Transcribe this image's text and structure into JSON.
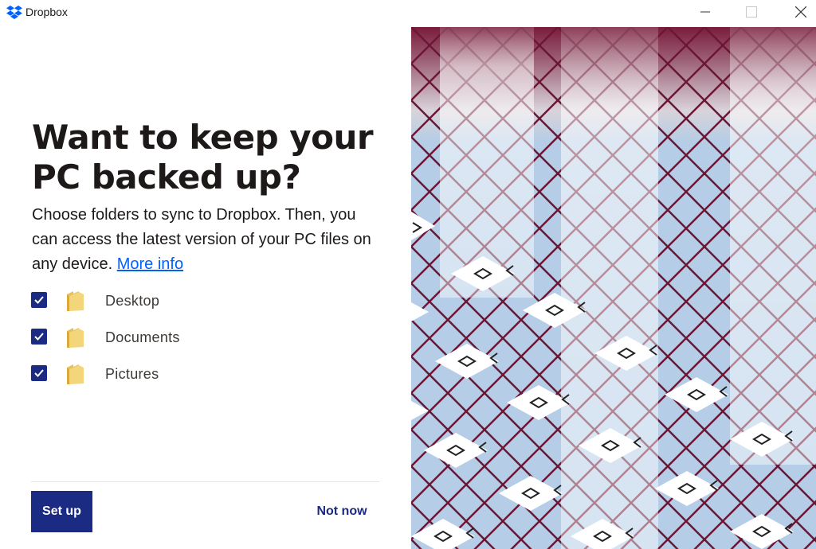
{
  "window": {
    "app_title": "Dropbox",
    "minimize_glyph": "minimize-icon",
    "maximize_glyph": "maximize-icon",
    "close_glyph": "close-icon"
  },
  "onboarding": {
    "headline_line1": "Want to keep your",
    "headline_line2": "PC backed up?",
    "description": "Choose folders to sync to Dropbox. Then, you can access the latest version of your PC files on any device.",
    "more_info_link": "More info",
    "folders": [
      {
        "label": "Desktop",
        "checked": true
      },
      {
        "label": "Documents",
        "checked": true
      },
      {
        "label": "Pictures",
        "checked": true
      }
    ],
    "primary_button": "Set up",
    "secondary_button": "Not now"
  },
  "colors": {
    "accent_navy": "#1b2a83",
    "link_blue": "#0061fe",
    "illustration_sky": "#b5cde6",
    "illustration_lattice": "#6b1634"
  }
}
